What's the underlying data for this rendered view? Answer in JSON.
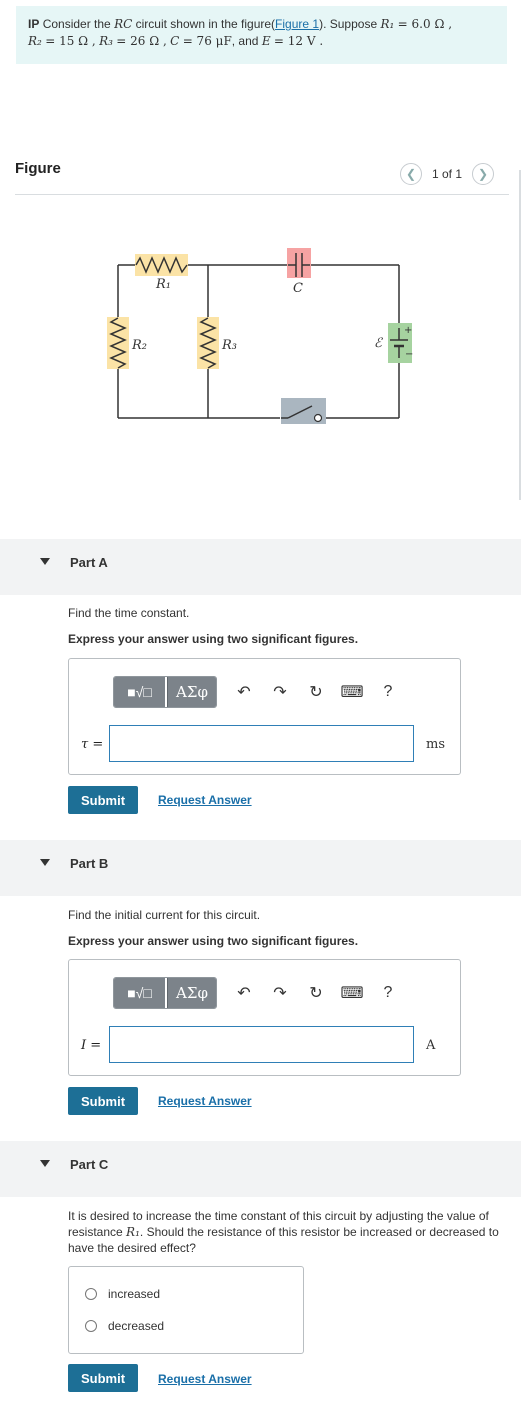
{
  "problem": {
    "prefix": "IP",
    "text_part1": "Consider the",
    "rc": "RC",
    "text_part2": "circuit shown in the figure(",
    "figure_link": "Figure 1",
    "text_part3": "). Suppose",
    "r1": "R₁",
    "r1_val": "= 6.0 Ω ,",
    "r2": "R₂",
    "r2_val": "= 15 Ω ,",
    "r3": "R₃",
    "r3_val": "= 26 Ω ,",
    "c": "C",
    "c_val": "= 76 μF",
    "e_text": ", and",
    "e": "E",
    "e_val": "= 12 V ."
  },
  "figure": {
    "title": "Figure",
    "counter": "1 of 1",
    "prev_icon": "chevron-left-icon",
    "next_icon": "chevron-right-icon",
    "labels": {
      "r1": "R₁",
      "r2": "R₂",
      "r3": "R₃",
      "c": "C",
      "emf": "ℰ",
      "plus": "+",
      "minus": "−"
    }
  },
  "parts": [
    {
      "label": "Part A",
      "question": "Find the time constant.",
      "instruction": "Express your answer using two significant figures.",
      "variable": "τ =",
      "unit": "ms",
      "input_value": "",
      "submit": "Submit",
      "request": "Request Answer"
    },
    {
      "label": "Part B",
      "question": "Find the initial current for this circuit.",
      "instruction": "Express your answer using two significant figures.",
      "variable": "I =",
      "unit": "A",
      "input_value": "",
      "submit": "Submit",
      "request": "Request Answer"
    },
    {
      "label": "Part C",
      "question_part1": "It is desired to increase the time constant of this circuit by adjusting the value of resistance",
      "question_r1": "R₁",
      "question_part2": ". Should the resistance of this resistor be increased or decreased to have the desired effect?",
      "options": [
        "increased",
        "decreased"
      ],
      "submit": "Submit",
      "request": "Request Answer"
    }
  ],
  "toolbar": {
    "template_glyph": "■√□",
    "greek_glyph": "ΑΣφ",
    "undo": "↶",
    "redo": "↷",
    "reset": "↻",
    "keyboard": "⌨",
    "help": "?"
  },
  "colors": {
    "problem_bg": "#e6f6f6",
    "submit_bg": "#1d6f96",
    "link": "#1a6fa8",
    "resistor_highlight": "#fbe3a6",
    "capacitor_highlight": "#f6a3a3",
    "battery_highlight": "#a6d3a0",
    "switch_highlight": "#aab6c0"
  }
}
